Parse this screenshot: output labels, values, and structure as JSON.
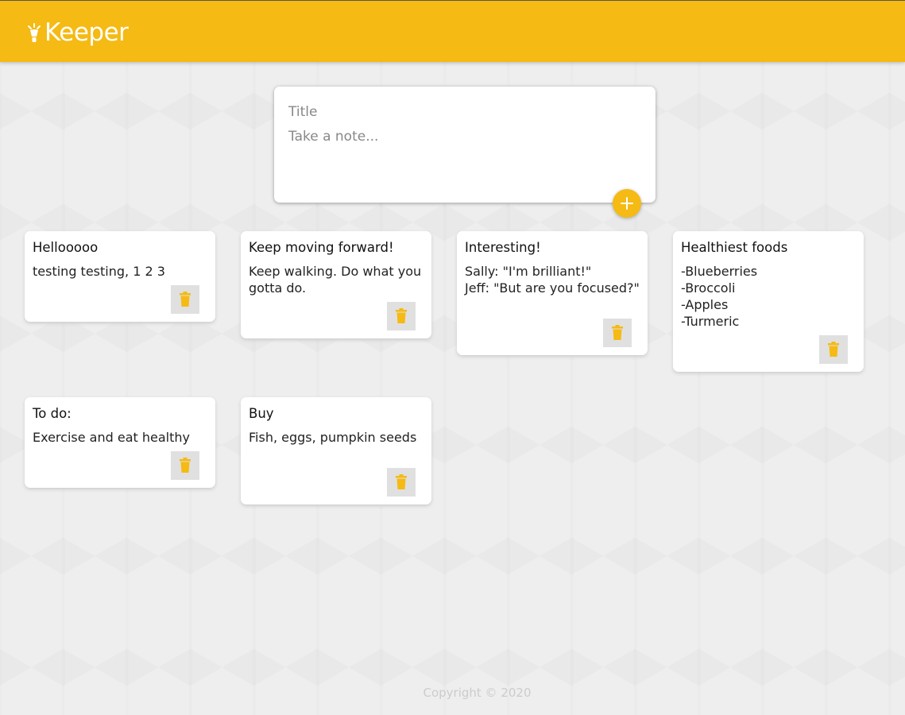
{
  "app": {
    "name": "Keeper",
    "accent_color": "#f5ba13",
    "logo_icon": "lightbulb-icon"
  },
  "create_note": {
    "title_placeholder": "Title",
    "content_placeholder": "Take a note...",
    "add_icon": "plus-icon"
  },
  "notes": [
    {
      "title": "Hellooooo",
      "content": "testing testing, 1 2 3"
    },
    {
      "title": "Keep moving forward!",
      "content": "Keep walking. Do what you gotta do."
    },
    {
      "title": "Interesting!",
      "content": "Sally: \"I'm brilliant!\"\nJeff: \"But are you focused?\""
    },
    {
      "title": "Healthiest foods",
      "content": "-Blueberries\n-Broccoli\n-Apples\n-Turmeric"
    },
    {
      "title": "To do:",
      "content": "Exercise and eat healthy"
    },
    {
      "title": "Buy",
      "content": "Fish, eggs, pumpkin seeds"
    }
  ],
  "delete_icon": "trash-icon",
  "footer": {
    "copyright": "Copyright © 2020"
  }
}
